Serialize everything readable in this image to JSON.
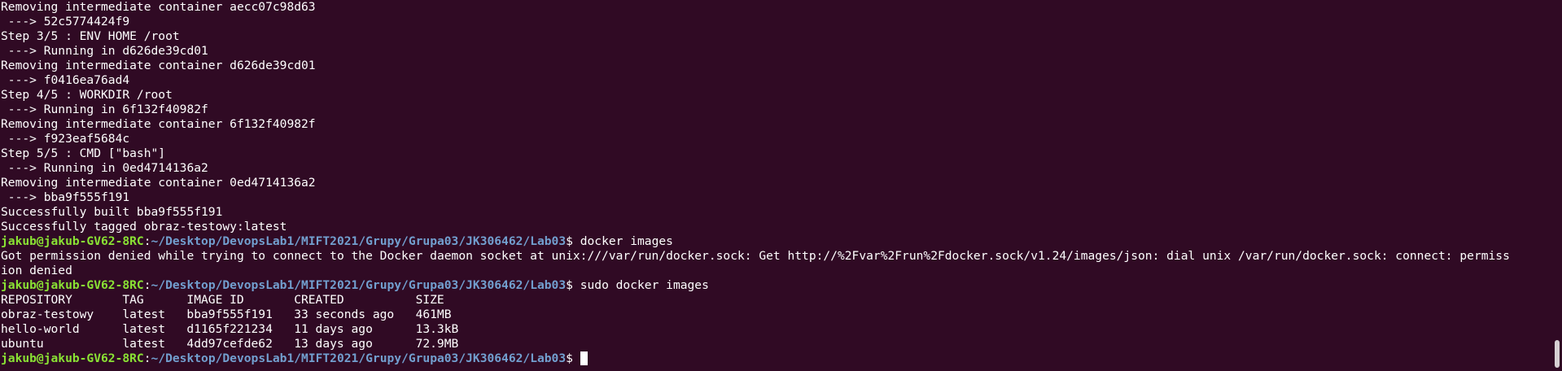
{
  "colors": {
    "background": "#300a24",
    "text": "#ffffff",
    "prompt_user": "#8ae234",
    "prompt_path": "#729fcf"
  },
  "terminal": {
    "output_lines": [
      "Removing intermediate container aecc07c98d63",
      " ---> 52c5774424f9",
      "Step 3/5 : ENV HOME /root",
      " ---> Running in d626de39cd01",
      "Removing intermediate container d626de39cd01",
      " ---> f0416ea76ad4",
      "Step 4/5 : WORKDIR /root",
      " ---> Running in 6f132f40982f",
      "Removing intermediate container 6f132f40982f",
      " ---> f923eaf5684c",
      "Step 5/5 : CMD [\"bash\"]",
      " ---> Running in 0ed4714136a2",
      "Removing intermediate container 0ed4714136a2",
      " ---> bba9f555f191",
      "Successfully built bba9f555f191",
      "Successfully tagged obraz-testowy:latest"
    ],
    "prompt": {
      "user_host": "jakub@jakub-GV62-8RC",
      "separator": ":",
      "path": "~/Desktop/DevopsLab1/MIFT2021/Grupy/Grupa03/JK306462/Lab03",
      "symbol": "$ "
    },
    "command_1": "docker images",
    "error_lines": [
      "Got permission denied while trying to connect to the Docker daemon socket at unix:///var/run/docker.sock: Get http://%2Fvar%2Frun%2Fdocker.sock/v1.24/images/json: dial unix /var/run/docker.sock: connect: permiss",
      "ion denied"
    ],
    "command_2": "sudo docker images",
    "images_table": {
      "headers": [
        "REPOSITORY",
        "TAG",
        "IMAGE ID",
        "CREATED",
        "SIZE"
      ],
      "rows": [
        [
          "obraz-testowy",
          "latest",
          "bba9f555f191",
          "33 seconds ago",
          "461MB"
        ],
        [
          "hello-world",
          "latest",
          "d1165f221234",
          "11 days ago",
          "13.3kB"
        ],
        [
          "ubuntu",
          "latest",
          "4dd97cefde62",
          "13 days ago",
          "72.9MB"
        ]
      ]
    }
  }
}
